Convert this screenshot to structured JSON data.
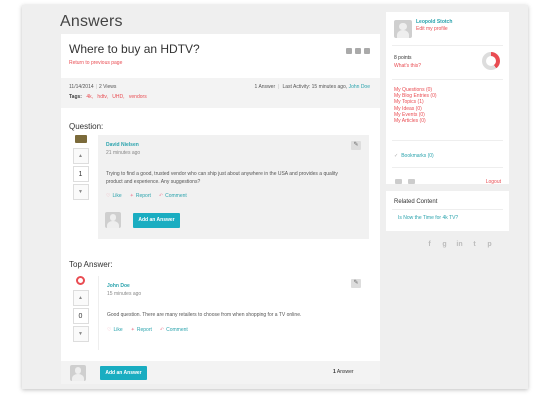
{
  "page": {
    "title": "Answers"
  },
  "question": {
    "title": "Where to buy an HDTV?",
    "return_link": "Return to previous page",
    "date": "11/14/2014",
    "views": "2 Views",
    "answers_count": "1 Answer",
    "last_activity_label": "Last Activity: 15 minutes ago,",
    "last_activity_user": "John Doe",
    "tags_label": "Tags:",
    "tags": [
      "4k,",
      "hdtv,",
      "UHD,",
      "vendors"
    ]
  },
  "question_section": {
    "label": "Question:",
    "vote_count": "1",
    "author": "David Nielsen",
    "time": "21 minutes ago",
    "body": "Trying to find a good, trusted vendor who can ship just about anywhere in the USA and provides a quality product and experience. Any suggestions?",
    "actions": {
      "like": "Like",
      "report": "Report",
      "comment": "Comment"
    },
    "add_answer": "Add an Answer"
  },
  "answer_section": {
    "label": "Top Answer:",
    "vote_count": "0",
    "author": "John Doe",
    "time": "15 minutes ago",
    "body": "Good question. There are many retailers to choose from when shopping for a TV online.",
    "actions": {
      "like": "Like",
      "report": "Report",
      "comment": "Comment"
    }
  },
  "bottom_bar": {
    "add_answer": "Add an Answer",
    "answer_count": "1",
    "answer_word": "Answer"
  },
  "sidebar": {
    "profile_name": "Leopold Stotch",
    "edit_profile": "Edit my profile",
    "points_value": "8",
    "points_word": "points",
    "whats_this": "What's this?",
    "links": [
      "My Questions (0)",
      "My Blog Entries (0)",
      "My Topics (1)",
      "My Ideas (0)",
      "My Events (0)",
      "My Articles (0)"
    ],
    "bookmarks": "Bookmarks (0)",
    "logout": "Logout"
  },
  "related": {
    "title": "Related Content",
    "link": "Is Now the Time for 4k TV?"
  },
  "social_icons": [
    "facebook-icon",
    "google-plus-icon",
    "linkedin-icon",
    "twitter-icon",
    "pinterest-icon"
  ],
  "colors": {
    "accent_teal": "#2aa3ad",
    "accent_red": "#e94c52",
    "button": "#1aadc1"
  }
}
